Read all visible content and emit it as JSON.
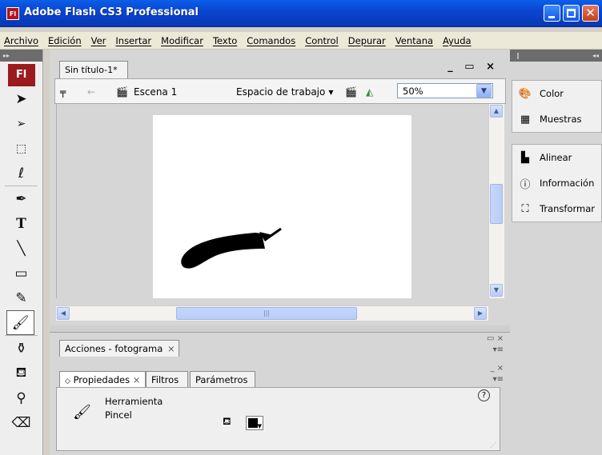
{
  "window": {
    "title": "Adobe Flash CS3 Professional",
    "app_icon_text": "Fl"
  },
  "menu": [
    "Archivo",
    "Edición",
    "Ver",
    "Insertar",
    "Modificar",
    "Texto",
    "Comandos",
    "Control",
    "Depurar",
    "Ventana",
    "Ayuda"
  ],
  "tools": {
    "logo": "Fl"
  },
  "document": {
    "tab_label": "Sin título-1*",
    "scene_label": "Escena 1",
    "workspace_label": "Espacio de trabajo",
    "zoom_value": "50%"
  },
  "bottom_panels": {
    "actions_tab": "Acciones - fotograma",
    "tabs": [
      "Propiedades",
      "Filtros",
      "Parámetros"
    ],
    "tool_type": "Herramienta",
    "tool_name": "Pincel"
  },
  "right_panels": {
    "group1": [
      "Color",
      "Muestras"
    ],
    "group2": [
      "Alinear",
      "Información",
      "Transformar"
    ]
  },
  "colors": {
    "title_bar": "#0a4fd8",
    "flash_brand": "#9b1a1e",
    "stroke_color": "#000000"
  }
}
